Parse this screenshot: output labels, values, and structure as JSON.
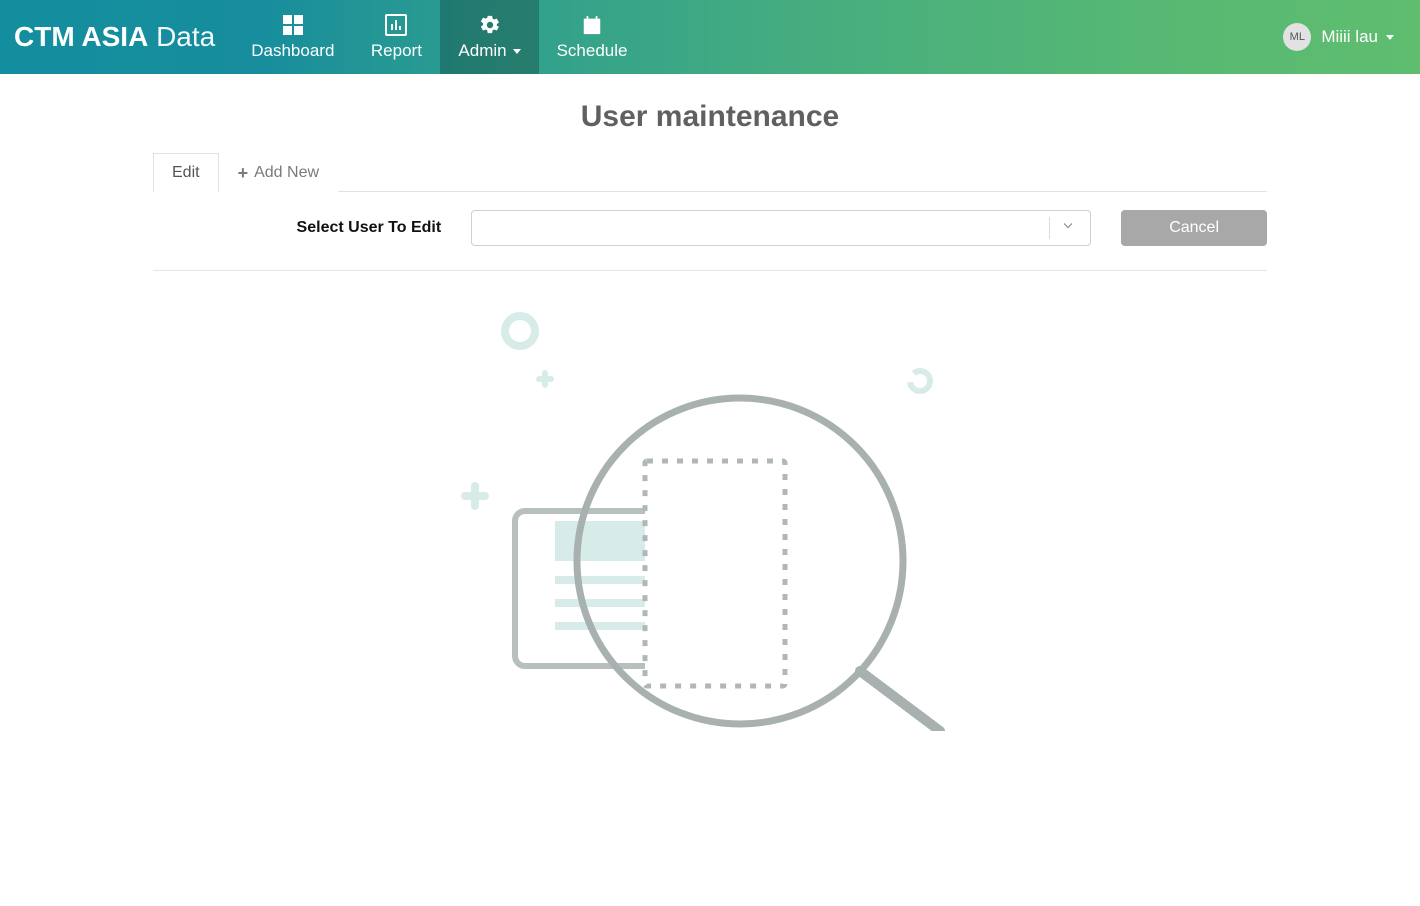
{
  "brand": {
    "bold": "CTM ASIA",
    "light": "Data"
  },
  "nav": {
    "dashboard": "Dashboard",
    "report": "Report",
    "admin": "Admin",
    "schedule": "Schedule"
  },
  "user": {
    "initials": "ML",
    "name": "Miiii lau"
  },
  "page": {
    "title": "User maintenance"
  },
  "tabs": {
    "edit": "Edit",
    "add": "Add New"
  },
  "form": {
    "select_label": "Select User To Edit",
    "cancel": "Cancel"
  }
}
